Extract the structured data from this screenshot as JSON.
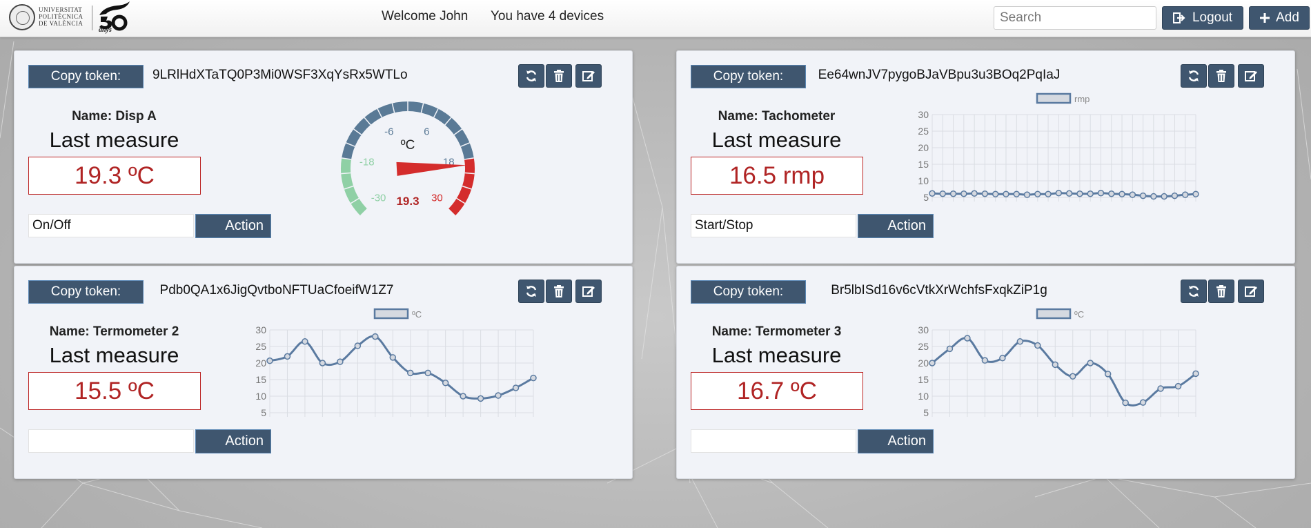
{
  "header": {
    "logo_lines": [
      "UNIVERSITAT",
      "POLITÈCNICA",
      "DE VALÈNCIA"
    ],
    "logo_anys": "anys",
    "welcome": "Welcome John",
    "devices_text": "You have 4 devices",
    "search_placeholder": "Search",
    "logout_label": "Logout",
    "add_label": "Add"
  },
  "colors": {
    "primary": "#3f566f",
    "measure": "#b02424",
    "line": "#5a7aa0"
  },
  "devices": [
    {
      "copy_label": "Copy token:",
      "token": "9LRlHdXTaTQ0P3Mi0WSF3XqYsRx5WTLo",
      "name": "Name: Disp A",
      "last_measure_label": "Last measure",
      "measure": "19.3 ºC",
      "action_input": "On/Off",
      "action_label": "Action",
      "widget": "gauge"
    },
    {
      "copy_label": "Copy token:",
      "token": "Ee64wnJV7pygoBJaVBpu3u3BOq2PqIaJ",
      "name": "Name: Tachometer",
      "last_measure_label": "Last measure",
      "measure": "16.5 rmp",
      "action_input": "Start/Stop",
      "action_label": "Action",
      "widget": "line"
    },
    {
      "copy_label": "Copy token:",
      "token": "Pdb0QA1x6JigQvtboNFTUaCfoeifW1Z7",
      "name": "Name: Termometer 2",
      "last_measure_label": "Last measure",
      "measure": "15.5 ºC",
      "action_input": "",
      "action_label": "Action",
      "widget": "line"
    },
    {
      "copy_label": "Copy token:",
      "token": "Br5lbISd16v6cVtkXrWchfsFxqkZiP1g",
      "name": "Name: Termometer 3",
      "last_measure_label": "Last measure",
      "measure": "16.7 ºC",
      "action_input": "",
      "action_label": "Action",
      "widget": "line"
    }
  ],
  "chart_data": [
    {
      "type": "gauge",
      "unit": "ºC",
      "value": 19.3,
      "value_label": "19.3",
      "min": -30,
      "max": 30,
      "tick_labels": [
        "-30",
        "-18",
        "-6",
        "6",
        "18",
        "30"
      ],
      "bands": [
        {
          "from": -30,
          "to": -18,
          "color": "#8fd0a5"
        },
        {
          "from": -18,
          "to": 18,
          "color": "#5a7a96"
        },
        {
          "from": 18,
          "to": 30,
          "color": "#d42c2c"
        }
      ]
    },
    {
      "type": "line",
      "legend": "rmp",
      "ylim": [
        5,
        30
      ],
      "yticks": [
        "30",
        "25",
        "20",
        "15",
        "10",
        "5"
      ],
      "series": [
        {
          "name": "rmp",
          "values": [
            6.2,
            6.1,
            6.1,
            6.1,
            6.2,
            6.1,
            6.0,
            6.0,
            6.0,
            5.8,
            6.0,
            6.0,
            6.3,
            6.2,
            6.1,
            6.1,
            6.3,
            6.1,
            6.0,
            5.8,
            5.5,
            5.3,
            5.3,
            5.5,
            5.8,
            6.0
          ]
        }
      ]
    },
    {
      "type": "line",
      "legend": "ºC",
      "ylim": [
        5,
        30
      ],
      "yticks": [
        "30",
        "25",
        "20",
        "15",
        "10",
        "5"
      ],
      "series": [
        {
          "name": "ºC",
          "values": [
            20.7,
            22.0,
            26.5,
            20.0,
            20.4,
            25.2,
            28.0,
            21.7,
            17.0,
            17.0,
            14.0,
            10.0,
            9.3,
            10.2,
            12.5,
            15.5
          ]
        }
      ]
    },
    {
      "type": "line",
      "legend": "ºC",
      "ylim": [
        5,
        30
      ],
      "yticks": [
        "30",
        "25",
        "20",
        "15",
        "10",
        "5"
      ],
      "series": [
        {
          "name": "ºC",
          "values": [
            20.0,
            24.3,
            27.5,
            20.8,
            21.5,
            26.5,
            25.3,
            19.5,
            16.0,
            20.0,
            16.7,
            8.0,
            8.1,
            12.3,
            13.0,
            16.8
          ]
        }
      ]
    }
  ]
}
